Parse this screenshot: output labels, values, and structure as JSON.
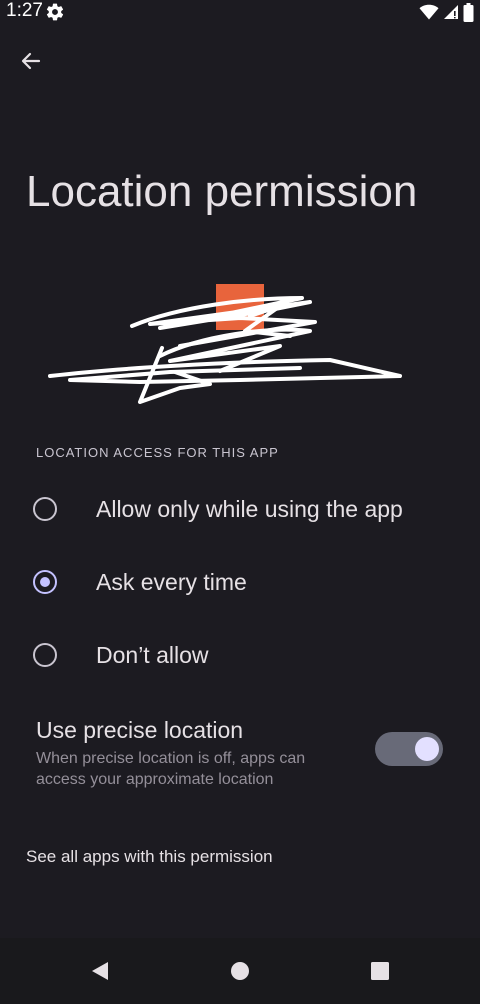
{
  "status_bar": {
    "time": "1:27",
    "icons": [
      "gear-icon",
      "wifi-icon",
      "signal-icon",
      "battery-icon"
    ]
  },
  "header": {
    "back_icon": "arrow-left-icon",
    "title": "Location permission"
  },
  "app_icon": {
    "accent_color": "#e8643c"
  },
  "section": {
    "header": "LOCATION ACCESS FOR THIS APP"
  },
  "options": [
    {
      "label": "Allow only while using the app",
      "selected": false
    },
    {
      "label": "Ask every time",
      "selected": true
    },
    {
      "label": "Don’t allow",
      "selected": false
    }
  ],
  "precise": {
    "title": "Use precise location",
    "description": "When precise location is off, apps can access your approximate location",
    "enabled": true
  },
  "footer": {
    "see_all_link": "See all apps with this permission"
  },
  "nav": {
    "icons": [
      "back-triangle-icon",
      "home-circle-icon",
      "recents-square-icon"
    ]
  },
  "colors": {
    "background": "#1c1b21",
    "accent": "#c4c2ff",
    "toggle_track": "#686a78",
    "secondary_text": "#948f99"
  }
}
